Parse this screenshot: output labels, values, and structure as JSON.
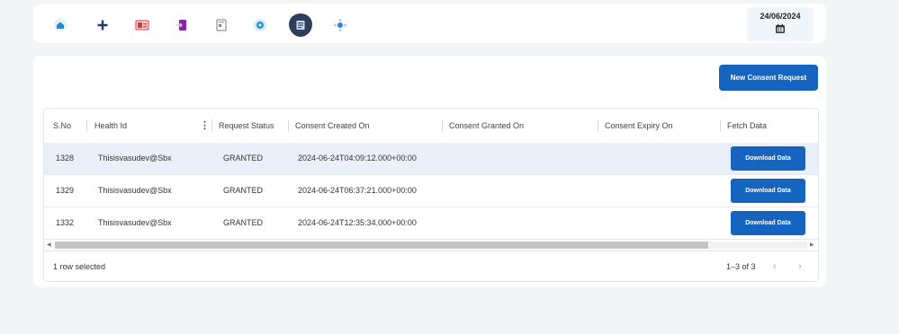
{
  "toolbar": {
    "icons": [
      "home-icon",
      "add-icon",
      "id-card-icon",
      "login-icon",
      "document-icon",
      "settings-gear-icon",
      "consent-pin-icon",
      "network-icon"
    ],
    "date": "24/06/2024"
  },
  "card": {
    "new_consent_label": "New Consent Request"
  },
  "table": {
    "headers": [
      "S.No",
      "Health Id",
      "Request Status",
      "Consent Created On",
      "Consent Granted On",
      "Consent Expiry On",
      "Fetch Data"
    ],
    "rows": [
      {
        "sno": "1328",
        "health_id": "Thisisvasudev@Sbx",
        "status": "GRANTED",
        "created": "2024-06-24T04:09:12.000+00:00",
        "granted": "",
        "expiry": "",
        "action": "Download Data"
      },
      {
        "sno": "1329",
        "health_id": "Thisisvasudev@Sbx",
        "status": "GRANTED",
        "created": "2024-06-24T06:37:21.000+00:00",
        "granted": "",
        "expiry": "",
        "action": "Download Data"
      },
      {
        "sno": "1332",
        "health_id": "Thisisvasudev@Sbx",
        "status": "GRANTED",
        "created": "2024-06-24T12:35:34.000+00:00",
        "granted": "",
        "expiry": "",
        "action": "Download Data"
      }
    ],
    "footer": {
      "selected_text": "1 row selected",
      "range_text": "1–3 of 3"
    }
  },
  "colors": {
    "primary": "#1565c0",
    "selected_row": "#e9f0fa",
    "page_bg": "#f3f4f6"
  }
}
